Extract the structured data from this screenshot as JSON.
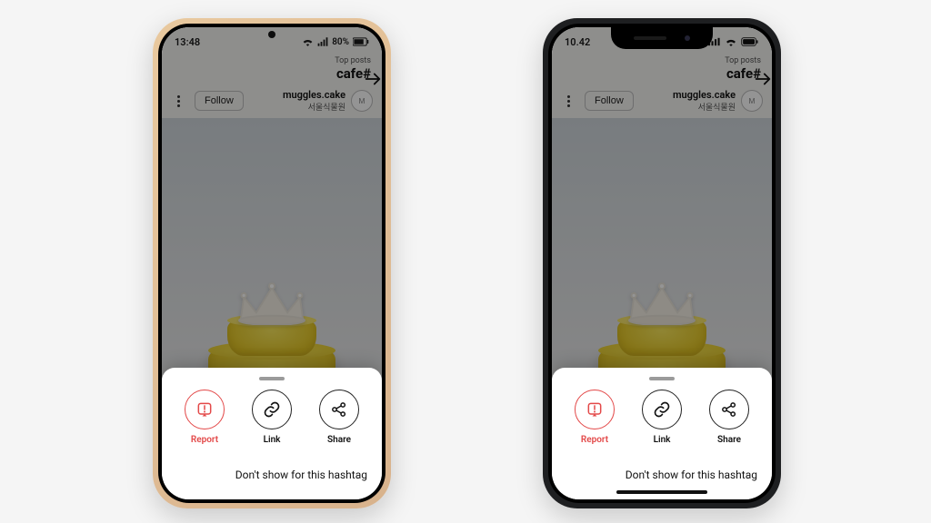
{
  "phones": {
    "android": {
      "time": "13:48",
      "battery_text": "80%"
    },
    "iphone": {
      "time": "10.42"
    }
  },
  "header": {
    "top_posts_label": "Top posts",
    "hashtag": "cafe#"
  },
  "user": {
    "follow_label": "Follow",
    "username": "muggles.cake",
    "subtitle": "서울식물원",
    "avatar_initials": "M"
  },
  "sheet": {
    "actions": {
      "report": "Report",
      "link": "Link",
      "share": "Share"
    },
    "row_dont_show": "Don't show for this hashtag"
  }
}
